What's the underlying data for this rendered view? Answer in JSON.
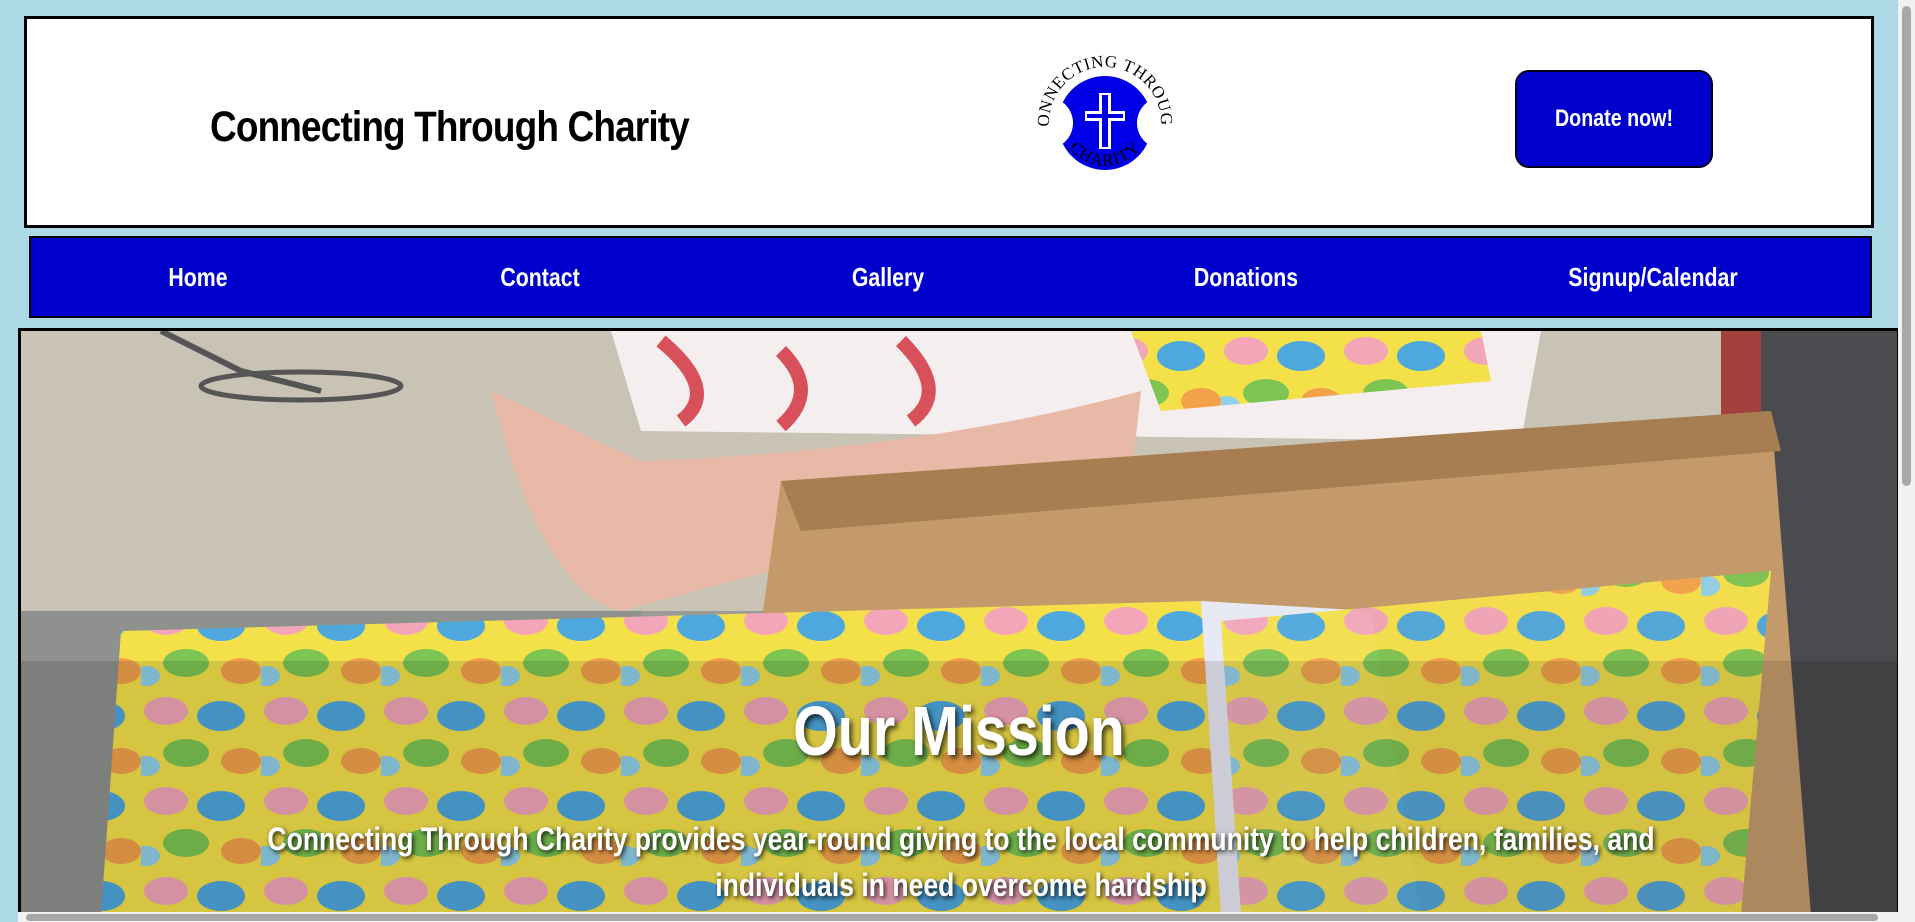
{
  "header": {
    "title": "Connecting Through Charity",
    "logo_text_top": "CONNECTING THROUGH",
    "logo_text_bottom": "CHARITY",
    "donate_label": "Donate now!"
  },
  "nav": {
    "items": [
      {
        "label": "Home"
      },
      {
        "label": "Contact"
      },
      {
        "label": "Gallery"
      },
      {
        "label": "Donations"
      },
      {
        "label": "Signup/Calendar"
      }
    ]
  },
  "hero": {
    "heading": "Our Mission",
    "text": "Connecting Through Charity provides year-round giving to the local community to help children, families, and individuals in need overcome hardship"
  },
  "colors": {
    "background": "#add8e6",
    "brand_blue": "#0000cd",
    "text_dark": "#000000",
    "text_light": "#ffffff"
  },
  "icons": {
    "logo": "cross-emblem-icon"
  }
}
